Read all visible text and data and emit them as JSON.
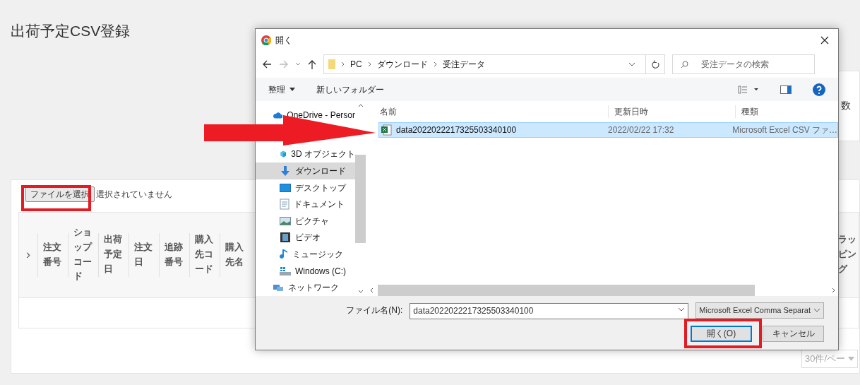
{
  "page": {
    "title": "出荷予定CSV登録"
  },
  "summary_card": {
    "column_label": "数"
  },
  "upload": {
    "button": "ファイルを選択",
    "status": "選択されていません"
  },
  "table": {
    "expand_icon": "›",
    "columns": [
      "注文番号",
      "ショップコード",
      "出荷予定日",
      "注文日",
      "追跡番号",
      "購入先コード",
      "購入先名"
    ],
    "right_columns": [
      "ラッピング"
    ]
  },
  "pagination": {
    "page_size": "30件/ペー"
  },
  "dialog": {
    "title": "開く",
    "path": [
      "PC",
      "ダウンロード",
      "受注データ"
    ],
    "search": {
      "placeholder": "受注データの検索"
    },
    "toolbar": {
      "organize": "整理",
      "new_folder": "新しいフォルダー"
    },
    "nav_items": [
      {
        "label": "OneDrive - Persor",
        "kind": "cloud",
        "selected": false
      },
      {
        "label": "3D オブジェクト",
        "kind": "cube",
        "selected": false
      },
      {
        "label": "ダウンロード",
        "kind": "download",
        "selected": true
      },
      {
        "label": "デスクトップ",
        "kind": "desktop",
        "selected": false
      },
      {
        "label": "ドキュメント",
        "kind": "document",
        "selected": false
      },
      {
        "label": "ピクチャ",
        "kind": "picture",
        "selected": false
      },
      {
        "label": "ビデオ",
        "kind": "video",
        "selected": false
      },
      {
        "label": "ミュージック",
        "kind": "music",
        "selected": false
      },
      {
        "label": "Windows (C:)",
        "kind": "drive",
        "selected": false
      },
      {
        "label": "ネットワーク",
        "kind": "network",
        "selected": false
      }
    ],
    "columns": [
      "名前",
      "更新日時",
      "種類"
    ],
    "files": [
      {
        "name": "data2022022217325503340100",
        "modified": "2022/02/22 17:32",
        "type": "Microsoft Excel CSV ファ…",
        "selected": true
      }
    ],
    "filename_label": "ファイル名(N):",
    "filename": "data2022022217325503340100",
    "filetype": "Microsoft Excel Comma Separat",
    "open_button": "開く(O)",
    "cancel_button": "キャンセル"
  }
}
